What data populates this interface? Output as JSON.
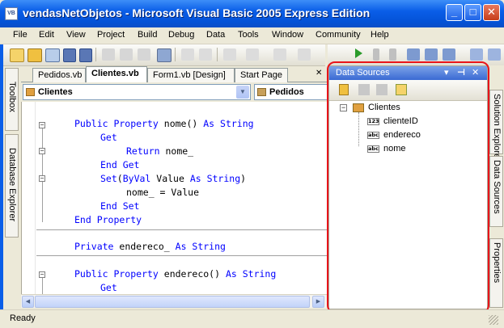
{
  "window": {
    "title": "vendasNetObjetos - Microsoft Visual Basic 2005 Express Edition",
    "app_icon_text": "VB",
    "controls": {
      "minimize": "_",
      "maximize": "□",
      "close": "✕"
    }
  },
  "menu": [
    "File",
    "Edit",
    "View",
    "Project",
    "Build",
    "Debug",
    "Data",
    "Tools",
    "Window",
    "Community",
    "Help"
  ],
  "left_sidebar": {
    "toolbox": "Toolbox",
    "database_explorer": "Database Explorer"
  },
  "tabs": [
    {
      "label": "Pedidos.vb",
      "active": false
    },
    {
      "label": "Clientes.vb",
      "active": true
    },
    {
      "label": "Form1.vb [Design]",
      "active": false
    },
    {
      "label": "Start Page",
      "active": false
    }
  ],
  "tab_close": "✕",
  "dropdowns": {
    "class": "Clientes",
    "member": "Pedidos"
  },
  "code": {
    "l1": {
      "kw1": "Public Property",
      "txt1": " nome() ",
      "kw2": "As String"
    },
    "l2": {
      "kw1": "Get"
    },
    "l3": {
      "kw1": "Return",
      "txt1": " nome_"
    },
    "l4": {
      "kw1": "End Get"
    },
    "l5": {
      "kw1": "Set",
      "txt1": "(",
      "kw2": "ByVal",
      "txt2": " Value ",
      "kw3": "As String",
      "txt3": ")"
    },
    "l6": {
      "txt1": "nome_ = Value"
    },
    "l7": {
      "kw1": "End Set"
    },
    "l8": {
      "kw1": "End Property"
    },
    "l9": {
      "kw1": "Private",
      "txt1": " endereco_ ",
      "kw2": "As String"
    },
    "l10": {
      "kw1": "Public Property",
      "txt1": " endereco() ",
      "kw2": "As String"
    },
    "l11": {
      "kw1": "Get"
    }
  },
  "data_sources": {
    "title": "Data Sources",
    "title_buttons": {
      "dropdown": "▾",
      "pin": "⊣",
      "close": "✕"
    },
    "tree": {
      "expander": "−",
      "root": "Clientes",
      "fields": [
        {
          "label": "clienteID",
          "type_icon": "123"
        },
        {
          "label": "endereco",
          "type_icon": "abc"
        },
        {
          "label": "nome",
          "type_icon": "abc"
        }
      ]
    }
  },
  "right_sidebar": {
    "solution_explorer": "Solution Explorer",
    "data_sources": "Data Sources",
    "properties": "Properties"
  },
  "status": {
    "text": "Ready"
  },
  "colors": {
    "keyword": "#0000ff",
    "highlight": "#e8141a",
    "titlebar": "#0a5ee8"
  }
}
